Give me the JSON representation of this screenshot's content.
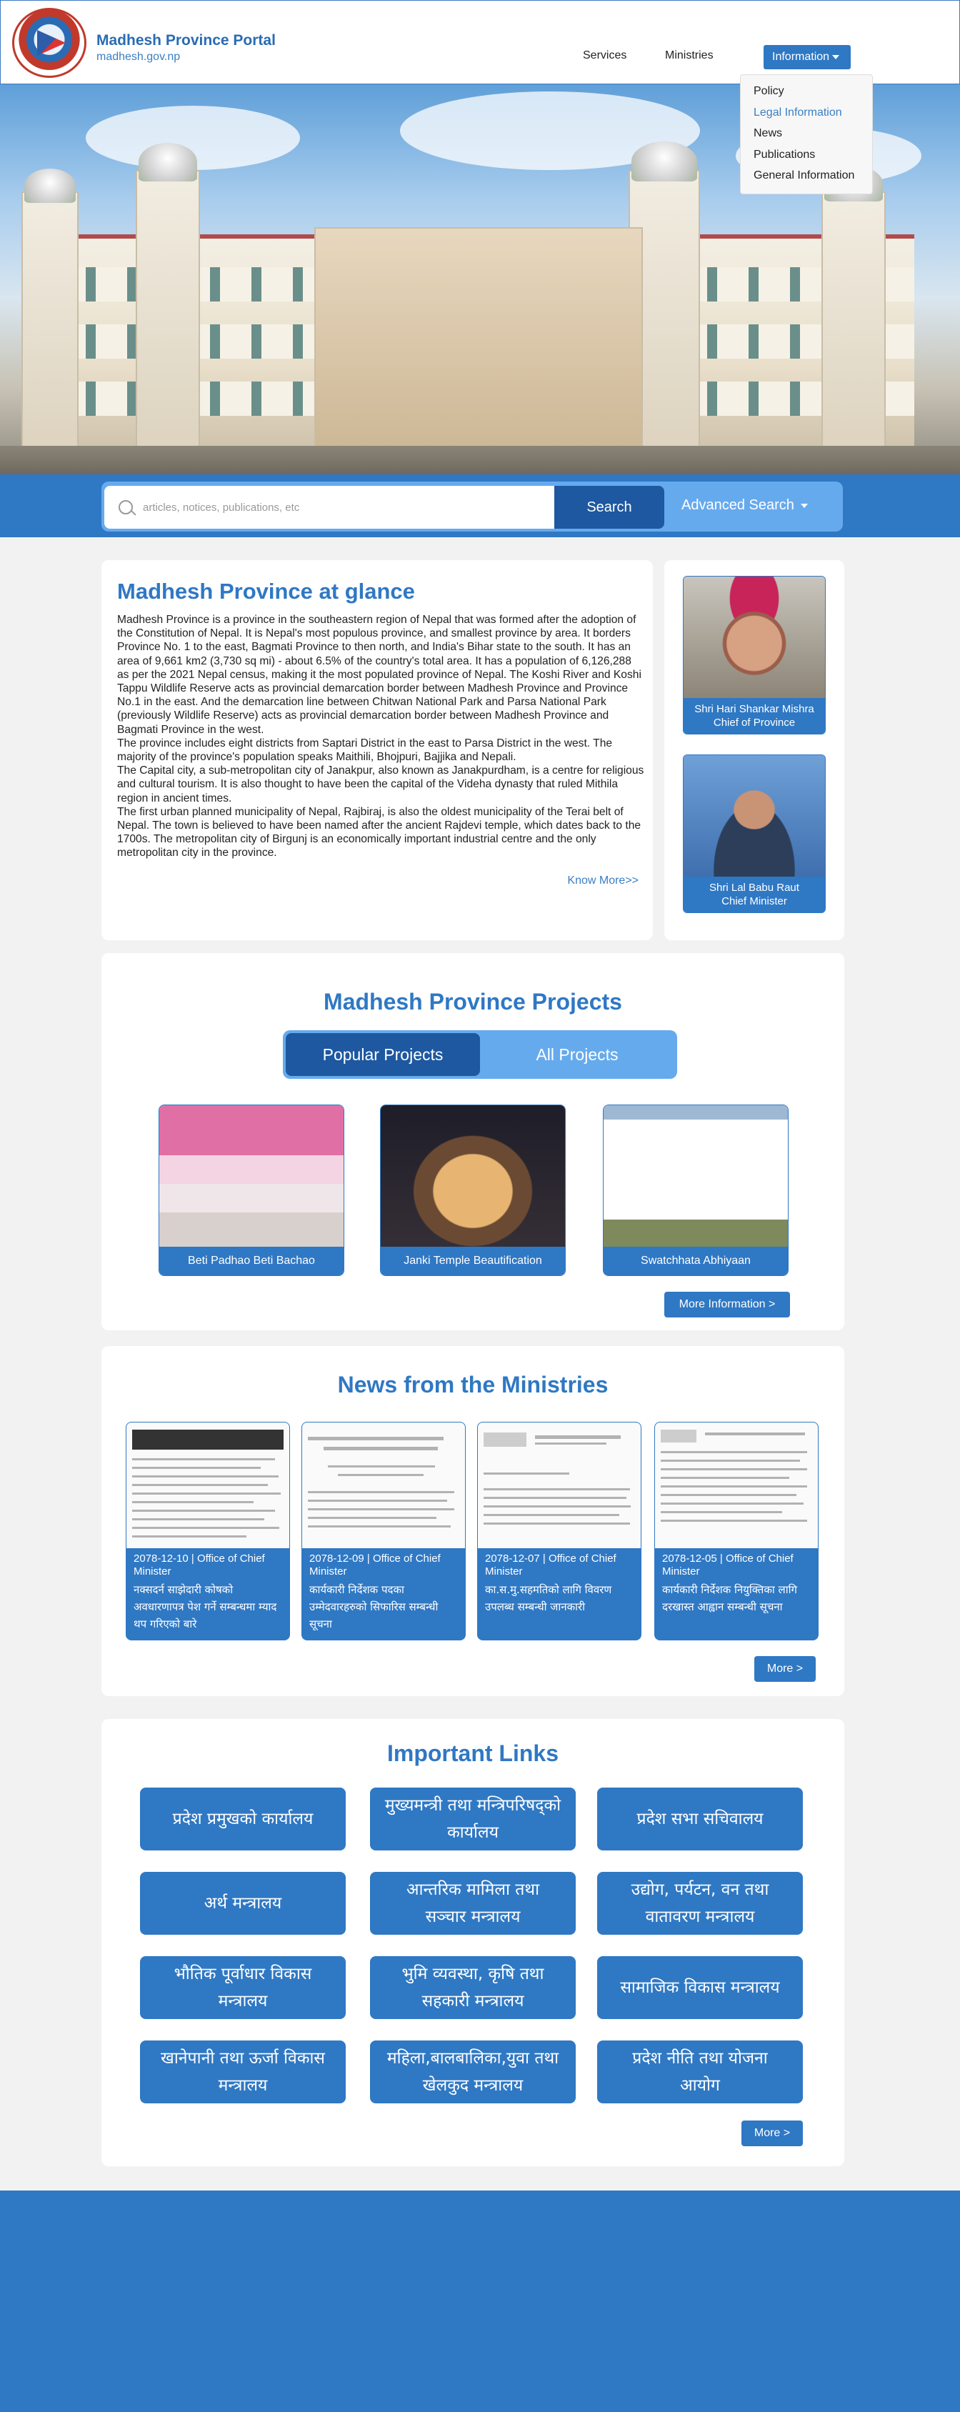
{
  "header": {
    "title": "Madhesh Province Portal",
    "domain": "madhesh.gov.np",
    "nav": {
      "services": "Services",
      "ministries": "Ministries",
      "information": "Information"
    },
    "dropdown": [
      "Policy",
      "Legal Information",
      "News",
      "Publications",
      "General Information"
    ],
    "dropdown_active_index": 1
  },
  "search": {
    "placeholder": "articles, notices, publications, etc",
    "button": "Search",
    "advanced": "Advanced Search"
  },
  "glance": {
    "title": "Madhesh Province at glance",
    "paragraphs": [
      "Madhesh Province is a province in the southeastern region of Nepal that was formed after the adoption of the Constitution of Nepal. It is Nepal's most populous province, and smallest province by area. It borders Province No. 1 to the east, Bagmati Province to then north, and India's Bihar state to the south. It has an area of 9,661 km2 (3,730 sq mi) -  about 6.5% of the country's total area. It has a population of 6,126,288 as per the 2021 Nepal census, making it the most populated province of Nepal. The Koshi River and Koshi Tappu Wildlife Reserve acts as provincial demarcation border between Madhesh Province and Province No.1 in the east. And the demarcation line between Chitwan National Park and Parsa National Park (previously Wildlife Reserve) acts as provincial demarcation border between Madhesh Province and Bagmati Province in the west.",
      "The province includes eight districts from Saptari District in the east to Parsa District in the west. The majority of the province's population speaks Maithili, Bhojpuri, Bajjika and Nepali.",
      "The Capital city, a sub-metropolitan city of Janakpur, also known as Janakpurdham, is a centre for religious and cultural tourism. It is also thought to have been the capital of the Videha dynasty that ruled Mithila region in ancient times.",
      "The first urban planned municipality of Nepal, Rajbiraj, is also the oldest municipality of the Terai belt of Nepal. The town is believed to have been named after the ancient Rajdevi temple, which dates back to the 1700s. The metropolitan city of Birgunj is an economically important industrial centre and the only metropolitan city in the province."
    ],
    "know_more": "Know More>>"
  },
  "leaders": [
    {
      "name": "Shri Hari Shankar Mishra",
      "role": "Chief of Province"
    },
    {
      "name": "Shri Lal Babu Raut",
      "role": "Chief Minister"
    }
  ],
  "projects": {
    "title": "Madhesh Province Projects",
    "tabs": [
      "Popular Projects",
      "All Projects"
    ],
    "items": [
      "Beti Padhao Beti Bachao",
      "Janki Temple Beautification",
      "Swatchhata Abhiyaan"
    ],
    "more": "More Information >"
  },
  "news": {
    "title": "News from the Ministries",
    "items": [
      {
        "meta": "2078-12-10 | Office of Chief Minister",
        "title": "नक्सदर्न साझेदारी कोषको अवधारणापत्र पेश गर्ने सम्बन्धमा म्याद थप गरिएको बारे"
      },
      {
        "meta": "2078-12-09 | Office of Chief Minister",
        "title": "कार्यकारी निर्देशक पदका उम्मेदवारहरुको सिफारिस सम्बन्धी सूचना"
      },
      {
        "meta": "2078-12-07 | Office of Chief Minister",
        "title": "का.स.मु.सहमतिको लागि विवरण उपलब्ध सम्बन्धी जानकारी"
      },
      {
        "meta": "2078-12-05 | Office of Chief Minister",
        "title": "कार्यकारी निर्देशक नियुक्तिका लागि दरखास्त आह्वान सम्बन्धी सूचना"
      }
    ],
    "more": "More >"
  },
  "links": {
    "title": "Important Links",
    "items": [
      "प्रदेश प्रमुखको कार्यालय",
      "मुख्यमन्त्री तथा मन्त्रिपरिषद्को कार्यालय",
      "प्रदेश सभा सचिवालय",
      "अर्थ मन्त्रालय",
      "आन्तरिक मामिला तथा सञ्चार मन्त्रालय",
      "उद्योग, पर्यटन, वन तथा वातावरण मन्त्रालय",
      "भौतिक पूर्वाधार विकास मन्त्रालय",
      "भुमि व्यवस्था, कृषि तथा सहकारी मन्त्रालय",
      "सामाजिक विकास मन्त्रालय",
      "खानेपानी तथा ऊर्जा विकास मन्त्रालय",
      "महिला,बालबालिका,युवा तथा खेलकुद मन्त्रालय",
      "प्रदेश नीति तथा योजना आयोग"
    ],
    "more": "More >"
  },
  "colors": {
    "primary": "#2f78c4",
    "dark": "#1d58a0",
    "light": "#66aaee",
    "background": "#f2f2f2"
  }
}
